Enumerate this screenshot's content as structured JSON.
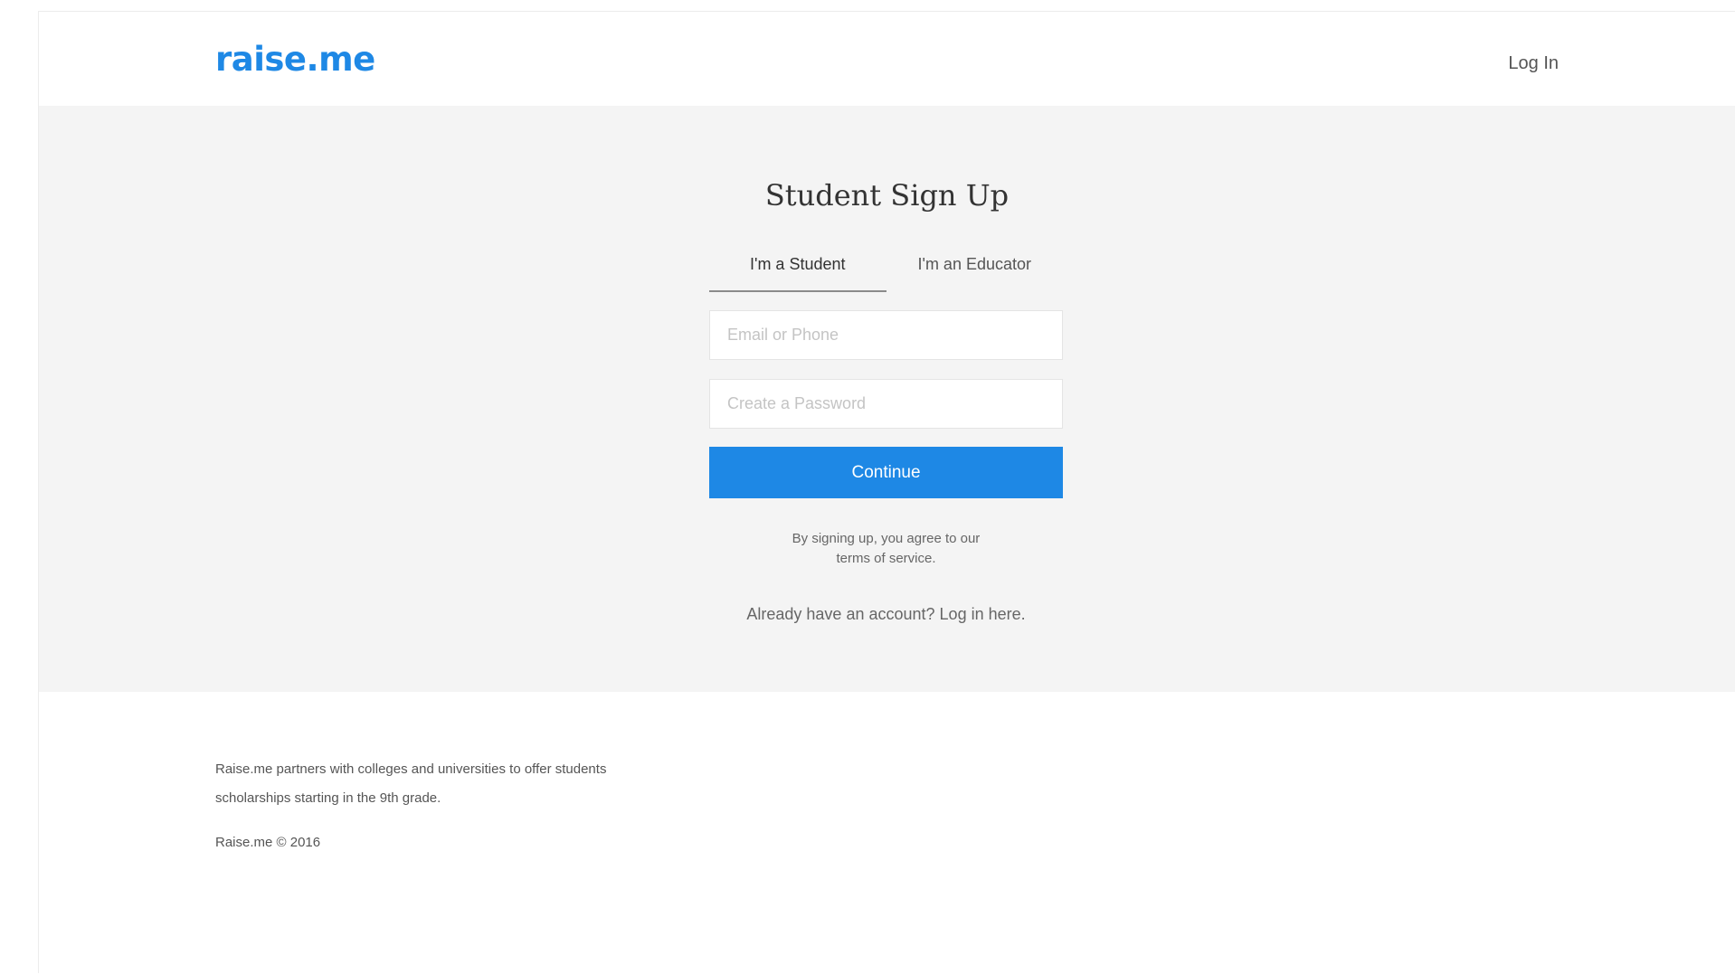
{
  "header": {
    "logo_text": "raise.me",
    "login_label": "Log In"
  },
  "signup": {
    "title": "Student Sign Up",
    "tabs": [
      {
        "label": "I'm a Student",
        "active": true
      },
      {
        "label": "I'm an Educator",
        "active": false
      }
    ],
    "email_placeholder": "Email or Phone",
    "password_placeholder": "Create a Password",
    "continue_label": "Continue",
    "terms_prefix": "By signing up, you agree to our",
    "terms_link": "terms of service.",
    "already_prefix": "Already have an account?",
    "already_link": "Log in here."
  },
  "footer": {
    "blurb": "Raise.me partners with colleges and universities to offer students scholarships starting in the 9th grade.",
    "copyright": "Raise.me © 2016"
  },
  "colors": {
    "brand_blue": "#1e88e5",
    "main_background": "#f4f4f4"
  }
}
